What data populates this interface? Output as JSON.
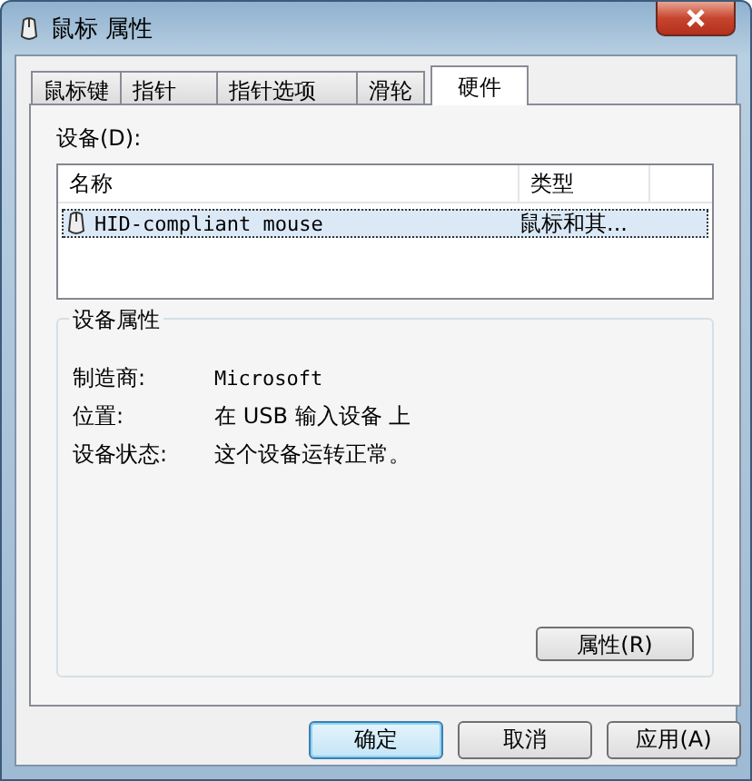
{
  "window": {
    "title": "鼠标 属性"
  },
  "tabs": [
    {
      "label": "鼠标键",
      "selected": false
    },
    {
      "label": "指针",
      "selected": false
    },
    {
      "label": "指针选项",
      "selected": false
    },
    {
      "label": "滑轮",
      "selected": false
    },
    {
      "label": "硬件",
      "selected": true
    }
  ],
  "devices": {
    "label": "设备(D):",
    "columns": [
      "名称",
      "类型"
    ],
    "rows": [
      {
        "name": "HID-compliant mouse",
        "type": "鼠标和其...",
        "selected": true
      }
    ]
  },
  "device_properties": {
    "title": "设备属性",
    "fields": [
      {
        "label": "制造商:",
        "value": "Microsoft"
      },
      {
        "label": "位置:",
        "value": "在 USB 输入设备 上"
      },
      {
        "label": "设备状态:",
        "value": "这个设备运转正常。"
      }
    ],
    "button": "属性(R)"
  },
  "buttons": [
    {
      "label": "确定",
      "kind": "default"
    },
    {
      "label": "取消",
      "kind": "normal"
    },
    {
      "label": "应用(A)",
      "kind": "normal"
    }
  ]
}
